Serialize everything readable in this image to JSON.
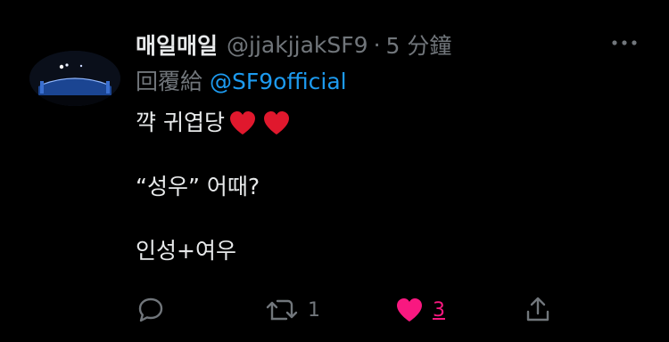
{
  "tweet": {
    "display_name": "매일매일",
    "handle": "@jjakjjakSF9",
    "separator": "·",
    "time": "5 分鐘",
    "reply_prefix": "回覆給",
    "reply_to": "@SF9official",
    "body_lines": [
      "꺅 귀엽당",
      "“성우” 어때?",
      "인성+여우"
    ],
    "body_emoji": [
      "heart-emoji",
      "heart-emoji"
    ]
  },
  "actions": {
    "reply_icon": "reply-icon",
    "retweet_icon": "retweet-icon",
    "retweet_count": "1",
    "like_icon": "heart-filled-icon",
    "like_count": "3",
    "share_icon": "share-icon"
  },
  "colors": {
    "background": "#000000",
    "text_primary": "#e7e9ea",
    "text_secondary": "#71767b",
    "link": "#1d9bf0",
    "like": "#f91880",
    "emoji_heart": "#e0182d"
  }
}
